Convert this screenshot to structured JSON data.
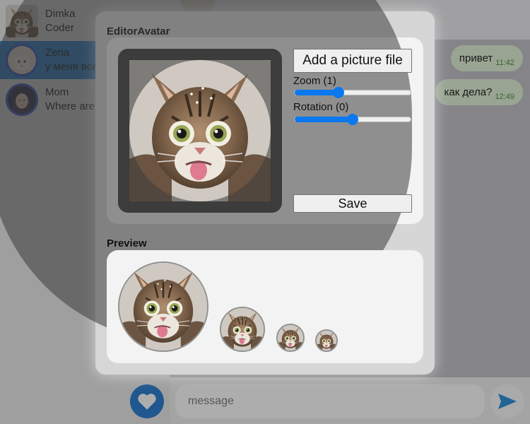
{
  "contacts": [
    {
      "name": "Dimka",
      "preview": "Coder"
    },
    {
      "name": "Zena",
      "preview": "у меня все"
    },
    {
      "name": "Mom",
      "preview": "Where are"
    }
  ],
  "messages": [
    {
      "text": "привет",
      "time": "11:42"
    },
    {
      "text": "как дела?",
      "time": "12:49"
    }
  ],
  "composer": {
    "placeholder": "message"
  },
  "editor": {
    "title": "EditorAvatar",
    "add_file_label": "Add a picture file",
    "zoom_label": "Zoom (1)",
    "zoom_value": 1,
    "zoom_fraction": 0.38,
    "rotation_label": "Rotation (0)",
    "rotation_value": 0,
    "rotation_fraction": 0.5,
    "save_label": "Save",
    "preview_title": "Preview"
  },
  "colors": {
    "accent": "#0a78f0",
    "active_contact": "#1f7fd6",
    "bubble": "#dff1d3",
    "time": "#3a8a3a"
  },
  "icons": [
    "cat-photo-icon",
    "heart-icon",
    "send-icon"
  ]
}
